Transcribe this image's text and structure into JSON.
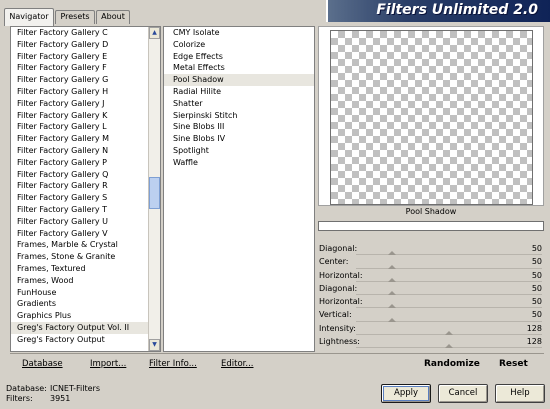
{
  "tabs": [
    {
      "label": "Navigator",
      "active": true
    },
    {
      "label": "Presets",
      "active": false
    },
    {
      "label": "About",
      "active": false
    }
  ],
  "banner": {
    "title": "Filters Unlimited 2.0"
  },
  "categories": [
    "Filter Factory Gallery C",
    "Filter Factory Gallery D",
    "Filter Factory Gallery E",
    "Filter Factory Gallery F",
    "Filter Factory Gallery G",
    "Filter Factory Gallery H",
    "Filter Factory Gallery J",
    "Filter Factory Gallery K",
    "Filter Factory Gallery L",
    "Filter Factory Gallery M",
    "Filter Factory Gallery N",
    "Filter Factory Gallery P",
    "Filter Factory Gallery Q",
    "Filter Factory Gallery R",
    "Filter Factory Gallery S",
    "Filter Factory Gallery T",
    "Filter Factory Gallery U",
    "Filter Factory Gallery V",
    "Frames, Marble & Crystal",
    "Frames, Stone & Granite",
    "Frames, Textured",
    "Frames, Wood",
    "FunHouse",
    "Gradients",
    "Graphics Plus",
    "Greg's Factory Output Vol. II",
    "Greg's Factory Output"
  ],
  "selected_category": "Greg's Factory Output Vol. II",
  "filters": [
    "CMY Isolate",
    "Colorize",
    "Edge Effects",
    "Metal Effects",
    "Pool Shadow",
    "Radial Hilite",
    "Shatter",
    "Sierpinski Stitch",
    "Sine Blobs III",
    "Sine Blobs IV",
    "Spotlight",
    "Waffle"
  ],
  "selected_filter": "Pool Shadow",
  "preview": {
    "filter_name": "Pool Shadow"
  },
  "params": [
    {
      "label": "Diagonal:",
      "value": "50"
    },
    {
      "label": "Center:",
      "value": "50"
    },
    {
      "label": "Horizontal:",
      "value": "50"
    },
    {
      "label": "Diagonal:",
      "value": "50"
    },
    {
      "label": "Horizontal:",
      "value": "50"
    },
    {
      "label": "Vertical:",
      "value": "50"
    },
    {
      "label": "Intensity:",
      "value": "128"
    },
    {
      "label": "Lightness:",
      "value": "128"
    }
  ],
  "bottom_links": {
    "database": "Database",
    "import": "Import...",
    "filter_info": "Filter Info...",
    "editor": "Editor...",
    "randomize": "Randomize",
    "reset": "Reset"
  },
  "status": {
    "database_key": "Database:",
    "database_val": "ICNET-Filters",
    "filters_key": "Filters:",
    "filters_val": "3951"
  },
  "buttons": {
    "apply": "Apply",
    "cancel": "Cancel",
    "help": "Help"
  }
}
